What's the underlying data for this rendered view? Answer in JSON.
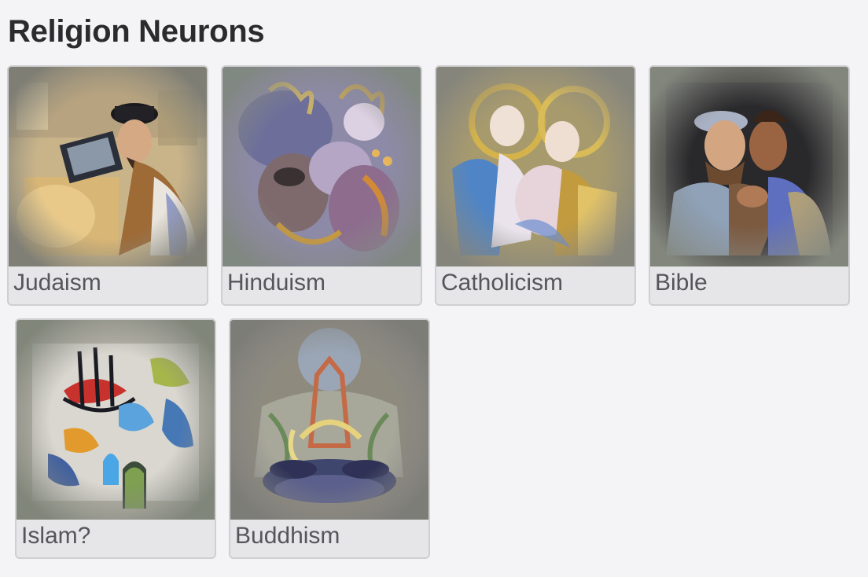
{
  "page": {
    "title": "Religion Neurons"
  },
  "neurons": [
    {
      "label": "Judaism",
      "icon": "judaism-neuron-visualization"
    },
    {
      "label": "Hinduism",
      "icon": "hinduism-neuron-visualization"
    },
    {
      "label": "Catholicism",
      "icon": "catholicism-neuron-visualization"
    },
    {
      "label": "Bible",
      "icon": "bible-neuron-visualization"
    },
    {
      "label": "Islam?",
      "icon": "islam-neuron-visualization"
    },
    {
      "label": "Buddhism",
      "icon": "buddhism-neuron-visualization"
    }
  ],
  "colors": {
    "background": "#f4f4f6",
    "card_background": "#e6e6e8",
    "card_border": "#cfcfd2",
    "title_text": "#2b2b2e",
    "label_text": "#55555a"
  }
}
